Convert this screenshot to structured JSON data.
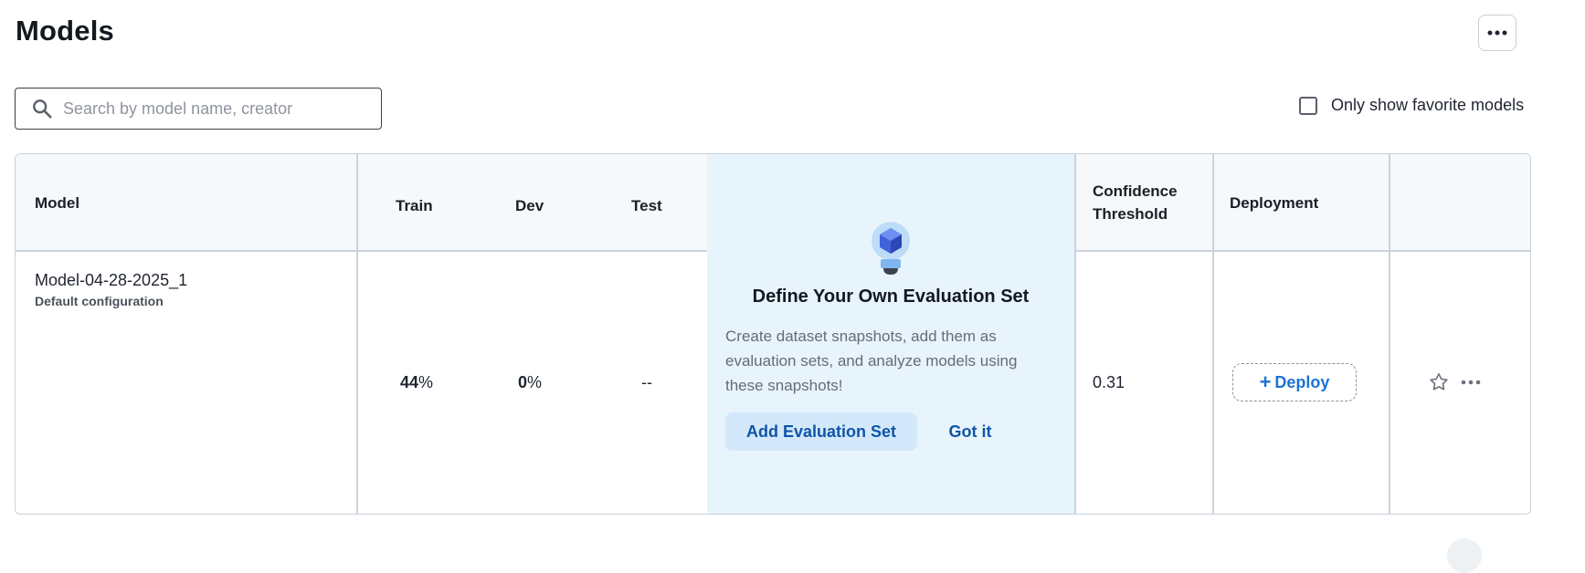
{
  "page": {
    "title": "Models"
  },
  "search": {
    "placeholder": "Search by model name, creator",
    "value": ""
  },
  "filter": {
    "label": "Only show favorite models",
    "checked": false
  },
  "table": {
    "headers": {
      "model": "Model",
      "train": "Train",
      "dev": "Dev",
      "test": "Test",
      "confidence_line1": "Confidence",
      "confidence_line2": "Threshold",
      "deployment": "Deployment"
    },
    "rows": [
      {
        "name": "Model-04-28-2025_1",
        "config": "Default configuration",
        "train": "44",
        "dev": "0",
        "percent": "%",
        "test": "--",
        "confidence": "0.31",
        "deploy_label": "Deploy"
      }
    ]
  },
  "eval_prompt": {
    "title": "Define Your Own Evaluation Set",
    "description": "Create dataset snapshots, add them as evaluation sets, and analyze models using these snapshots!",
    "add_label": "Add Evaluation Set",
    "dismiss_label": "Got it"
  },
  "icons": {
    "more": "more-horizontal-icon",
    "search": "search-icon",
    "lightbulb": "lightbulb-cube-icon",
    "plus": "plus-icon",
    "star": "star-outline-icon"
  },
  "colors": {
    "accent": "#1a73d6",
    "eval_bg": "#e8f4fc",
    "eval_button_bg": "#d3e9fb",
    "eval_button_text": "#0f55a8",
    "border": "#c9d3de"
  }
}
